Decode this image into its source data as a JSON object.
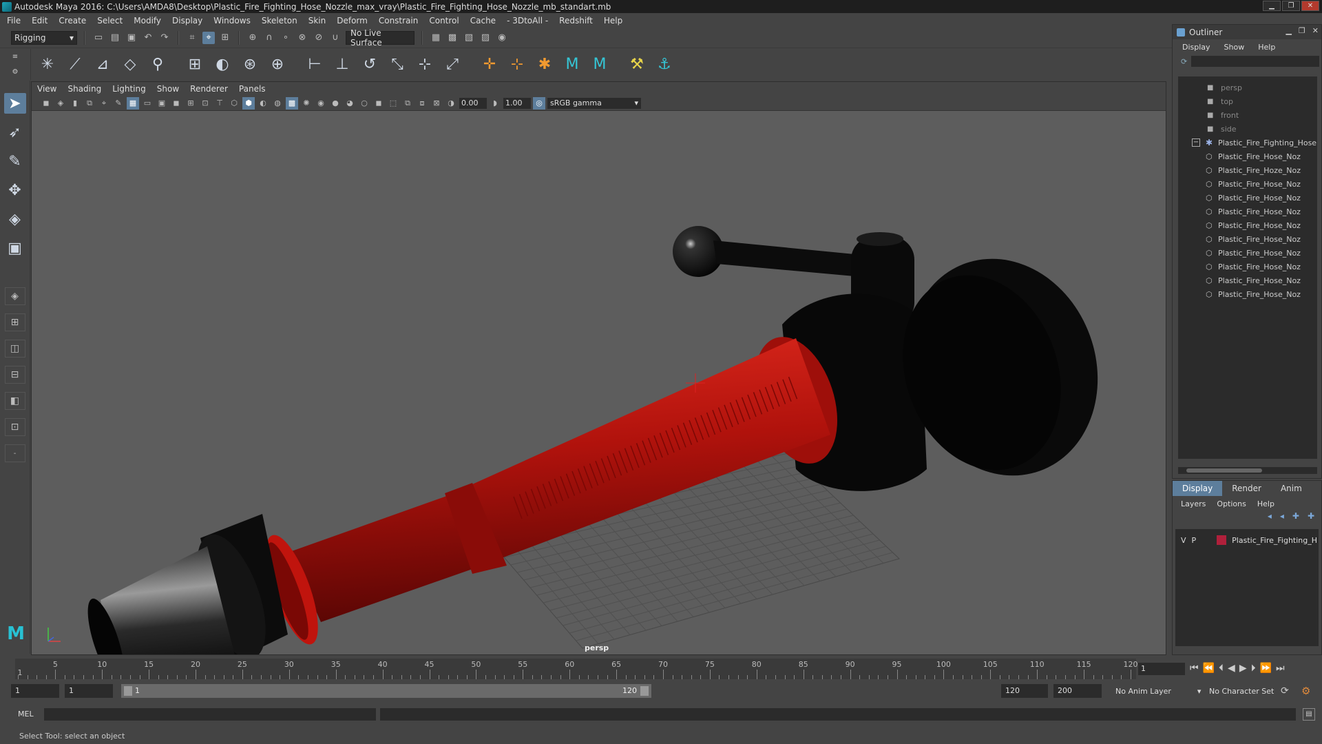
{
  "window": {
    "title": "Autodesk Maya 2016: C:\\Users\\AMDA8\\Desktop\\Plastic_Fire_Fighting_Hose_Nozzle_max_vray\\Plastic_Fire_Fighting_Hose_Nozzle_mb_standart.mb"
  },
  "menubar": [
    "File",
    "Edit",
    "Create",
    "Select",
    "Modify",
    "Display",
    "Windows",
    "Skeleton",
    "Skin",
    "Deform",
    "Constrain",
    "Control",
    "Cache",
    "- 3DtoAll -",
    "Redshift",
    "Help"
  ],
  "statusline": {
    "menuset": "Rigging",
    "live_surface": "No Live Surface"
  },
  "panel": {
    "menu": [
      "View",
      "Shading",
      "Lighting",
      "Show",
      "Renderer",
      "Panels"
    ],
    "exposure": "0.00",
    "gamma_value": "1.00",
    "color_space": "sRGB gamma",
    "camera_label": "persp"
  },
  "outliner": {
    "title": "Outliner",
    "menu": [
      "Display",
      "Show",
      "Help"
    ],
    "cameras": [
      "persp",
      "top",
      "front",
      "side"
    ],
    "group": "Plastic_Fire_Fighting_Hose",
    "children": [
      "Plastic_Fire_Hose_Noz",
      "Plastic_Fire_Hoze_Noz",
      "Plastic_Fire_Hose_Noz",
      "Plastic_Fire_Hose_Noz",
      "Plastic_Fire_Hose_Noz",
      "Plastic_Fire_Hose_Noz",
      "Plastic_Fire_Hose_Noz",
      "Plastic_Fire_Hose_Noz",
      "Plastic_Fire_Hose_Noz",
      "Plastic_Fire_Hose_Noz",
      "Plastic_Fire_Hose_Noz"
    ]
  },
  "layer_editor": {
    "tabs": [
      "Display",
      "Render",
      "Anim"
    ],
    "menu": [
      "Layers",
      "Options",
      "Help"
    ],
    "layer": {
      "v": "V",
      "p": "P",
      "name": "Plastic_Fire_Fighting_H",
      "color": "#b0203b"
    }
  },
  "timeline": {
    "ticks": [
      "5",
      "10",
      "15",
      "20",
      "25",
      "30",
      "35",
      "40",
      "45",
      "50",
      "55",
      "60",
      "65",
      "70",
      "75",
      "80",
      "85",
      "90",
      "95",
      "100",
      "105",
      "110",
      "115",
      "120"
    ],
    "start_mark": "1",
    "current_frame": "1"
  },
  "range": {
    "start": "1",
    "start2": "1",
    "range_start": "1",
    "range_end": "120",
    "end": "120",
    "anim_end": "200",
    "anim_layer": "No Anim Layer",
    "char_set": "No Character Set"
  },
  "cmdline": {
    "label": "MEL"
  },
  "helpline": {
    "text": "Select Tool: select an object"
  }
}
